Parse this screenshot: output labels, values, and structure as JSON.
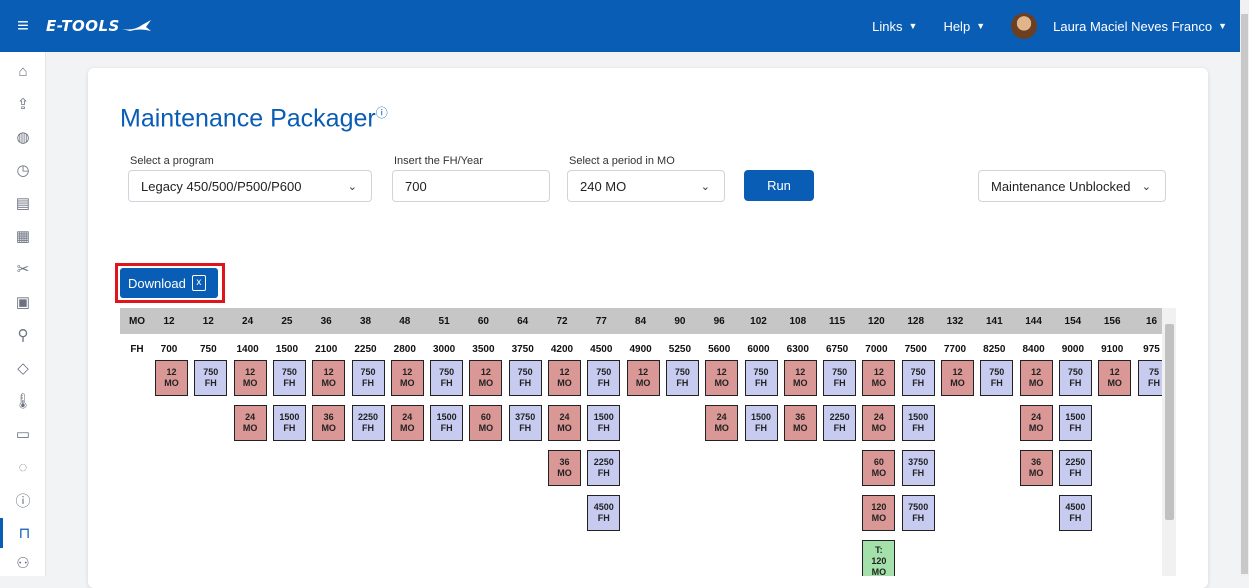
{
  "topbar": {
    "brand": "E-TOOLS",
    "links_label": "Links",
    "help_label": "Help",
    "user_name": "Laura Maciel Neves Franco"
  },
  "sidebar": {
    "icons": [
      "home-icon",
      "upload-icon",
      "globe-icon",
      "clock-icon",
      "document-icon",
      "table-icon",
      "tools-icon",
      "badge-icon",
      "search-icon",
      "tag-icon",
      "thermometer-icon",
      "calendar-icon",
      "gauge-icon",
      "alert-icon",
      "package-icon",
      "users-icon"
    ]
  },
  "page": {
    "title": "Maintenance Packager",
    "title_icon": "ⓘ"
  },
  "form": {
    "program_label": "Select a program",
    "program_value": "Legacy 450/500/P500/P600",
    "fh_label": "Insert the FH/Year",
    "fh_value": "700",
    "period_label": "Select a period in MO",
    "period_value": "240 MO",
    "run_label": "Run",
    "status_value": "Maintenance Unblocked"
  },
  "download": {
    "label": "Download"
  },
  "table": {
    "mo_label": "MO",
    "fh_label": "FH",
    "mo": [
      "12",
      "12",
      "24",
      "25",
      "36",
      "38",
      "48",
      "51",
      "60",
      "64",
      "72",
      "77",
      "84",
      "90",
      "96",
      "102",
      "108",
      "115",
      "120",
      "128",
      "132",
      "141",
      "144",
      "154",
      "156",
      "16"
    ],
    "fh": [
      "700",
      "750",
      "1400",
      "1500",
      "2100",
      "2250",
      "2800",
      "3000",
      "3500",
      "3750",
      "4200",
      "4500",
      "4900",
      "5250",
      "5600",
      "6000",
      "6300",
      "6750",
      "7000",
      "7500",
      "7700",
      "8250",
      "8400",
      "9000",
      "9100",
      "975"
    ],
    "columns": [
      [
        [
          "12",
          "MO",
          "mo"
        ]
      ],
      [
        [
          "750",
          "FH",
          "fh"
        ]
      ],
      [
        [
          "12",
          "MO",
          "mo"
        ],
        [
          "24",
          "MO",
          "mo"
        ]
      ],
      [
        [
          "750",
          "FH",
          "fh"
        ],
        [
          "1500",
          "FH",
          "fh"
        ]
      ],
      [
        [
          "12",
          "MO",
          "mo"
        ],
        [
          "36",
          "MO",
          "mo"
        ]
      ],
      [
        [
          "750",
          "FH",
          "fh"
        ],
        [
          "2250",
          "FH",
          "fh"
        ]
      ],
      [
        [
          "12",
          "MO",
          "mo"
        ],
        [
          "24",
          "MO",
          "mo"
        ]
      ],
      [
        [
          "750",
          "FH",
          "fh"
        ],
        [
          "1500",
          "FH",
          "fh"
        ]
      ],
      [
        [
          "12",
          "MO",
          "mo"
        ],
        [
          "60",
          "MO",
          "mo"
        ]
      ],
      [
        [
          "750",
          "FH",
          "fh"
        ],
        [
          "3750",
          "FH",
          "fh"
        ]
      ],
      [
        [
          "12",
          "MO",
          "mo"
        ],
        [
          "24",
          "MO",
          "mo"
        ],
        [
          "36",
          "MO",
          "mo"
        ]
      ],
      [
        [
          "750",
          "FH",
          "fh"
        ],
        [
          "1500",
          "FH",
          "fh"
        ],
        [
          "2250",
          "FH",
          "fh"
        ],
        [
          "4500",
          "FH",
          "fh"
        ]
      ],
      [
        [
          "12",
          "MO",
          "mo"
        ]
      ],
      [
        [
          "750",
          "FH",
          "fh"
        ]
      ],
      [
        [
          "12",
          "MO",
          "mo"
        ],
        [
          "24",
          "MO",
          "mo"
        ]
      ],
      [
        [
          "750",
          "FH",
          "fh"
        ],
        [
          "1500",
          "FH",
          "fh"
        ]
      ],
      [
        [
          "12",
          "MO",
          "mo"
        ],
        [
          "36",
          "MO",
          "mo"
        ]
      ],
      [
        [
          "750",
          "FH",
          "fh"
        ],
        [
          "2250",
          "FH",
          "fh"
        ]
      ],
      [
        [
          "12",
          "MO",
          "mo"
        ],
        [
          "24",
          "MO",
          "mo"
        ],
        [
          "60",
          "MO",
          "mo"
        ],
        [
          "120",
          "MO",
          "mo"
        ],
        [
          "T:|120",
          "MO",
          "t"
        ]
      ],
      [
        [
          "750",
          "FH",
          "fh"
        ],
        [
          "1500",
          "FH",
          "fh"
        ],
        [
          "3750",
          "FH",
          "fh"
        ],
        [
          "7500",
          "FH",
          "fh"
        ]
      ],
      [
        [
          "12",
          "MO",
          "mo"
        ]
      ],
      [
        [
          "750",
          "FH",
          "fh"
        ]
      ],
      [
        [
          "12",
          "MO",
          "mo"
        ],
        [
          "24",
          "MO",
          "mo"
        ],
        [
          "36",
          "MO",
          "mo"
        ]
      ],
      [
        [
          "750",
          "FH",
          "fh"
        ],
        [
          "1500",
          "FH",
          "fh"
        ],
        [
          "2250",
          "FH",
          "fh"
        ],
        [
          "4500",
          "FH",
          "fh"
        ]
      ],
      [
        [
          "12",
          "MO",
          "mo"
        ]
      ],
      [
        [
          "75",
          "FH",
          "fh"
        ]
      ]
    ]
  }
}
